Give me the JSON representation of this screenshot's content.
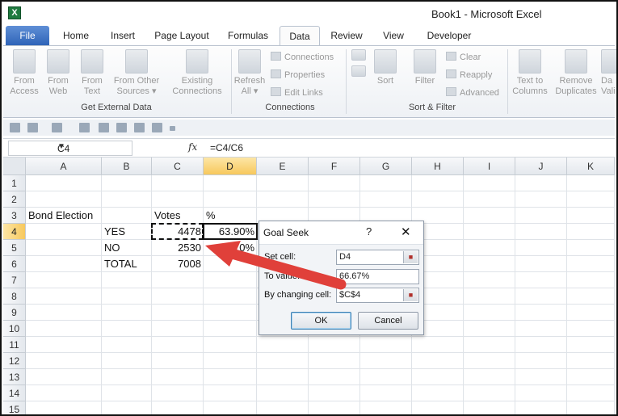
{
  "window": {
    "title": "Book1 - Microsoft Excel",
    "app_icon_letter": "X"
  },
  "tabs": [
    {
      "label": "File"
    },
    {
      "label": "Home"
    },
    {
      "label": "Insert"
    },
    {
      "label": "Page Layout"
    },
    {
      "label": "Formulas"
    },
    {
      "label": "Data"
    },
    {
      "label": "Review"
    },
    {
      "label": "View"
    },
    {
      "label": "Developer"
    }
  ],
  "active_tab": "Data",
  "ribbon": {
    "groups": {
      "external": "Get External Data",
      "connections": "Connections",
      "sortfilter": "Sort & Filter"
    },
    "buttons": {
      "from_access": [
        "From",
        "Access"
      ],
      "from_web": [
        "From",
        "Web"
      ],
      "from_text": [
        "From",
        "Text"
      ],
      "from_other": [
        "From Other",
        "Sources ▾"
      ],
      "existing": [
        "Existing",
        "Connections"
      ],
      "refresh": [
        "Refresh",
        "All ▾"
      ],
      "connections": "Connections",
      "properties": "Properties",
      "edit_links": "Edit Links",
      "sort": "Sort",
      "filter": "Filter",
      "clear": "Clear",
      "reapply": "Reapply",
      "advanced": "Advanced",
      "text_to_columns": [
        "Text to",
        "Columns"
      ],
      "remove_duplicates": [
        "Remove",
        "Duplicates"
      ],
      "data_validation": [
        "Da",
        "Vali"
      ]
    }
  },
  "formula_bar": {
    "name_box": "C4",
    "fx": "fx",
    "formula": "=C4/C6"
  },
  "columns": [
    "A",
    "B",
    "C",
    "D",
    "E",
    "F",
    "G",
    "H",
    "I",
    "J",
    "K"
  ],
  "rows": [
    "1",
    "2",
    "3",
    "4",
    "5",
    "6",
    "7",
    "8",
    "9",
    "10",
    "11",
    "12",
    "13",
    "14",
    "15"
  ],
  "cells": {
    "A3": "Bond Election",
    "C3": "Votes",
    "D3": "%",
    "B4": "YES",
    "C4": "4478",
    "D4": "63.90%",
    "B5": "NO",
    "C5": "2530",
    "D5": "36.10%",
    "B6": "TOTAL",
    "C6": "7008"
  },
  "dialog": {
    "title": "Goal Seek",
    "help": "?",
    "close": "✕",
    "set_cell_label": "Set cell:",
    "set_cell_value": "D4",
    "to_value_label": "To value:",
    "to_value_value": "66.67%",
    "changing_cell_label": "By changing cell:",
    "changing_cell_value": "$C$4",
    "ok": "OK",
    "cancel": "Cancel"
  },
  "colors": {
    "accent": "#3c7fb1",
    "arrow": "#e0403a",
    "header_selected": "#f7c85c",
    "file_tab": "#2f64b8"
  }
}
